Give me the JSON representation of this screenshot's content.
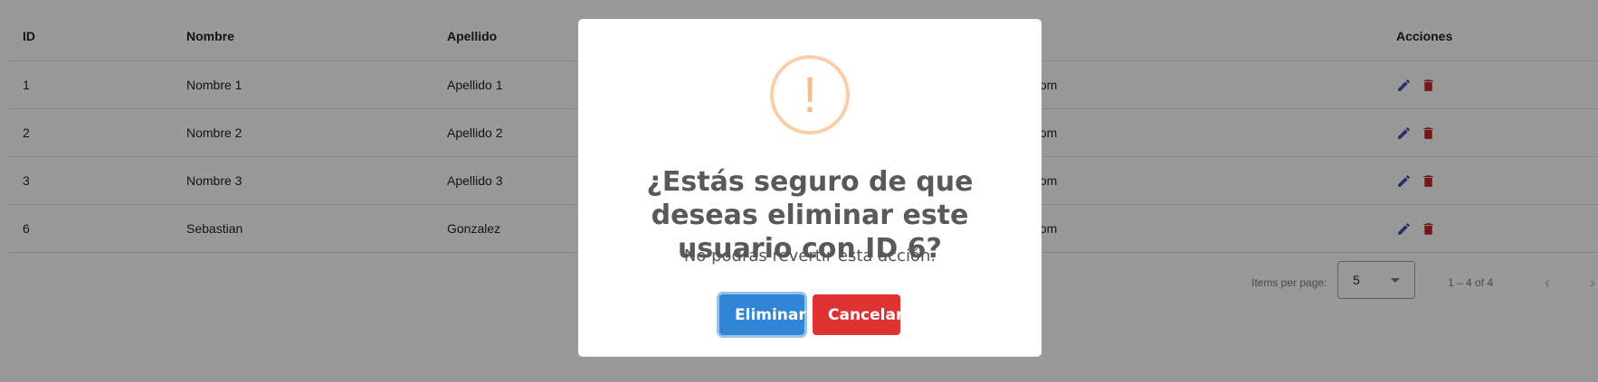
{
  "table": {
    "headers": {
      "id": "ID",
      "nombre": "Nombre",
      "apellido": "Apellido",
      "acciones": "Acciones"
    },
    "rows": [
      {
        "id": "1",
        "nombre": "Nombre 1",
        "apellido": "Apellido 1",
        "email_visible": "ail.com"
      },
      {
        "id": "2",
        "nombre": "Nombre 2",
        "apellido": "Apellido 2",
        "email_visible": "ail.com"
      },
      {
        "id": "3",
        "nombre": "Nombre 3",
        "apellido": "Apellido 3",
        "email_visible": "ail.com"
      },
      {
        "id": "6",
        "nombre": "Sebastian",
        "apellido": "Gonzalez",
        "email_visible": "ail.com"
      }
    ],
    "action_icons": {
      "edit": "edit-icon",
      "delete": "trash-icon"
    },
    "colors": {
      "edit": "#3f51b5",
      "delete": "#c62828"
    }
  },
  "paginator": {
    "items_per_page_label": "Items per page:",
    "page_size": "5",
    "range_label": "1 – 4 of 4",
    "prev_icon": "chevron-left-icon",
    "next_icon": "chevron-right-icon"
  },
  "dialog": {
    "icon": "warning-icon",
    "icon_glyph": "!",
    "title": "¿Estás seguro de que deseas eliminar este usuario con ID 6?",
    "text": "No podrás revertir esta acción.",
    "confirm_label": "Eliminar",
    "cancel_label": "Cancelar",
    "colors": {
      "confirm": "#3085d6",
      "cancel": "#dd3333",
      "icon": "#f8bb86"
    }
  }
}
